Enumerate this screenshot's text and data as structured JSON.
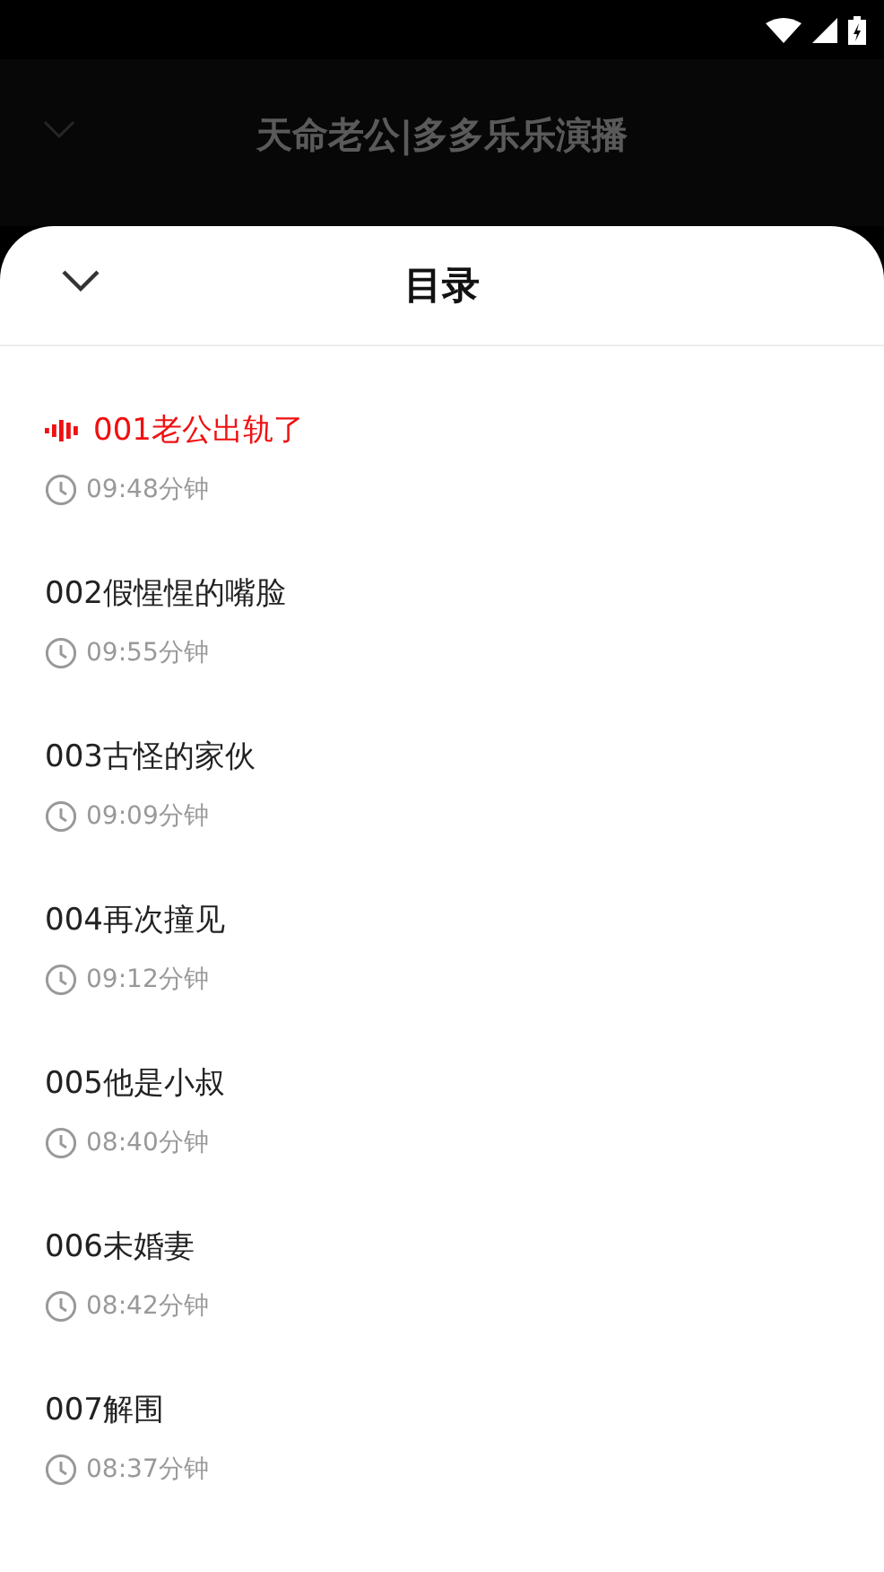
{
  "background": {
    "title": "天命老公|多多乐乐演播"
  },
  "sheet": {
    "title": "目录"
  },
  "chapters": [
    {
      "title": "001老公出轨了",
      "duration": "09:48分钟",
      "selected": true
    },
    {
      "title": "002假惺惺的嘴脸",
      "duration": "09:55分钟",
      "selected": false
    },
    {
      "title": "003古怪的家伙",
      "duration": "09:09分钟",
      "selected": false
    },
    {
      "title": "004再次撞见",
      "duration": "09:12分钟",
      "selected": false
    },
    {
      "title": "005他是小叔",
      "duration": "08:40分钟",
      "selected": false
    },
    {
      "title": "006未婚妻",
      "duration": "08:42分钟",
      "selected": false
    },
    {
      "title": "007解围",
      "duration": "08:37分钟",
      "selected": false
    }
  ]
}
